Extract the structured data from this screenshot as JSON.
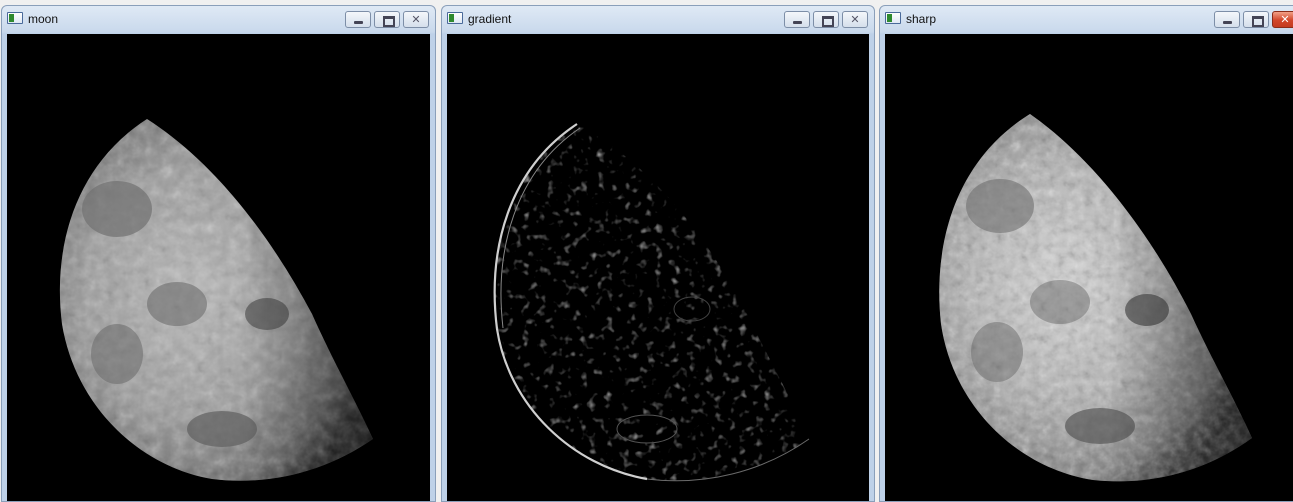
{
  "windows": [
    {
      "title": "moon",
      "controls": [
        "minimize",
        "maximize",
        "close"
      ],
      "close_active": false
    },
    {
      "title": "gradient",
      "controls": [
        "minimize",
        "maximize",
        "close"
      ],
      "close_active": false
    },
    {
      "title": "sharp",
      "controls": [
        "minimize",
        "maximize",
        "close"
      ],
      "close_active": true
    }
  ],
  "icons": {
    "window_icon": "app-window-icon",
    "minimize": "minimize-icon",
    "maximize": "maximize-icon",
    "close": "close-icon"
  },
  "colors": {
    "titlebar_top": "#dfe9f5",
    "titlebar_bottom": "#c9d9ec",
    "close_active": "#d2462a"
  }
}
